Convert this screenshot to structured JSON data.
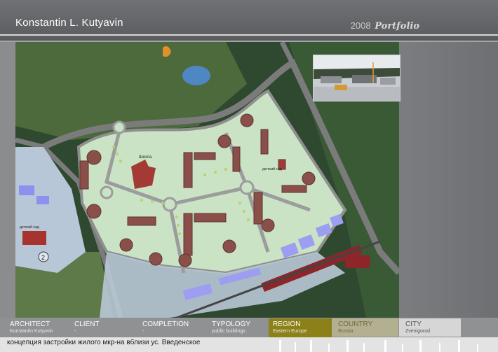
{
  "header": {
    "author": "Konstantin L. Kutyavin",
    "year": "2008",
    "portfolio": "Portfolio"
  },
  "map": {
    "labels": {
      "school": "Школа",
      "kindergarten_1": "детский сад",
      "kindergarten_2": "детский сад",
      "number_2": "2"
    }
  },
  "info": {
    "architect": {
      "label": "ARCHITECT",
      "value": "Konstantin Kutyavin"
    },
    "client": {
      "label": "CLIENT",
      "value": "-"
    },
    "completion": {
      "label": "COMPLETION",
      "value": "-"
    },
    "typology": {
      "label": "TYPOLOGY",
      "value": "public buildings"
    },
    "region": {
      "label": "REGION",
      "value": "Eastern Europe"
    },
    "country": {
      "label": "COUNTRY",
      "value": "Russia"
    },
    "city": {
      "label": "CITY",
      "value": "Zvenigorod"
    }
  },
  "caption": "концепция застройки жилого мкр-на вблизи ус. Введенское",
  "colors": {
    "region_bg": "#8c8018",
    "country_bg": "#b3b091",
    "forest": "#2f4a2f",
    "road": "#7a7a7a"
  }
}
